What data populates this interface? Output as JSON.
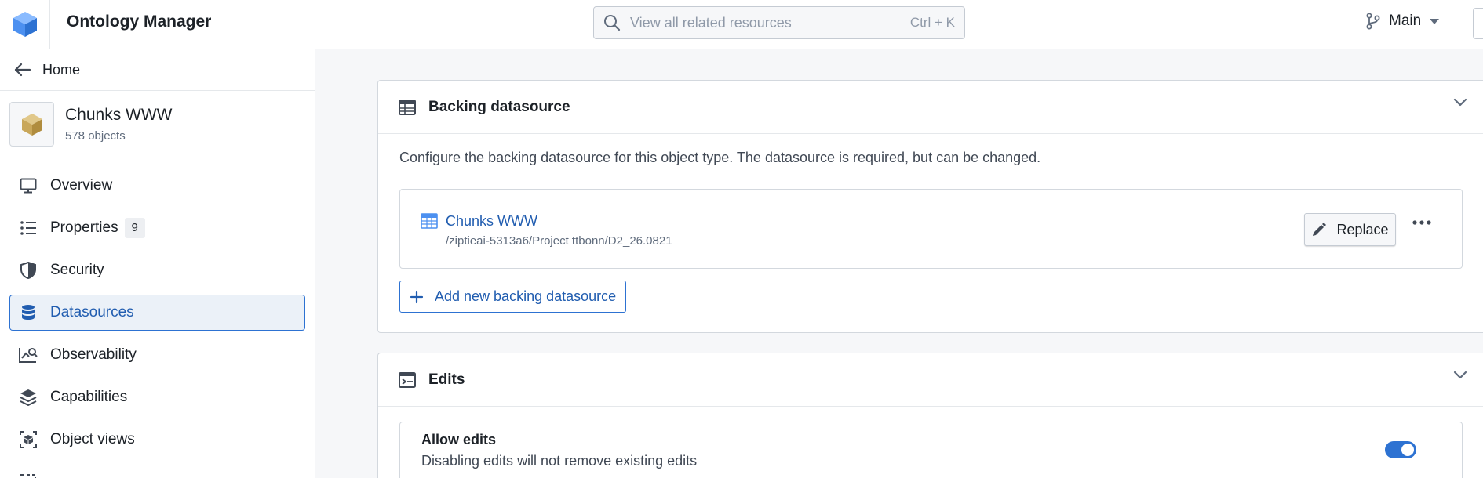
{
  "app": {
    "title": "Ontology Manager"
  },
  "search": {
    "placeholder": "View all related resources",
    "shortcut": "Ctrl + K"
  },
  "branch": {
    "name": "Main"
  },
  "sidebar": {
    "home_label": "Home",
    "object": {
      "name": "Chunks WWW",
      "count": "578 objects"
    },
    "items": [
      {
        "label": "Overview",
        "icon": "monitor-icon"
      },
      {
        "label": "Properties",
        "icon": "list-icon",
        "badge": "9"
      },
      {
        "label": "Security",
        "icon": "shield-icon"
      },
      {
        "label": "Datasources",
        "icon": "database-icon",
        "active": true
      },
      {
        "label": "Observability",
        "icon": "chart-search-icon"
      },
      {
        "label": "Capabilities",
        "icon": "layers-icon"
      },
      {
        "label": "Object views",
        "icon": "cube-view-icon"
      }
    ]
  },
  "backing": {
    "title": "Backing datasource",
    "description": "Configure the backing datasource for this object type. The datasource is required, but can be changed.",
    "datasource": {
      "name": "Chunks WWW",
      "path": "/ziptieai-5313a6/Project ttbonn/D2_26.0821"
    },
    "replace_label": "Replace",
    "add_label": "Add new backing datasource"
  },
  "edits": {
    "title": "Edits",
    "allow_title": "Allow edits",
    "allow_subtitle": "Disabling edits will not remove existing edits",
    "enabled": true
  },
  "colors": {
    "accent": "#2d72d2",
    "link": "#215db0",
    "logo": "#4c90f0",
    "object_icon": "#c9a75a"
  }
}
